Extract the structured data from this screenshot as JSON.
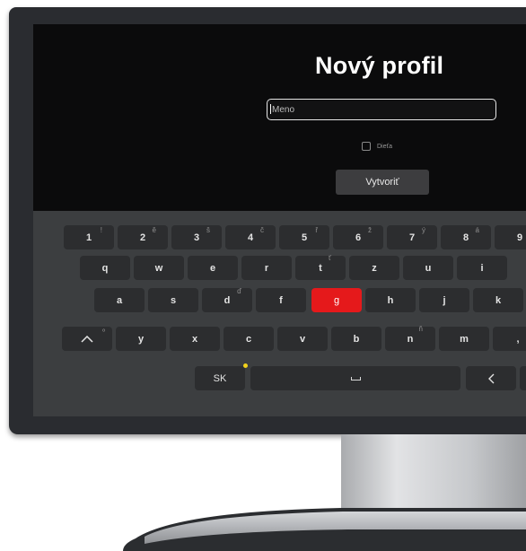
{
  "screen": {
    "title": "Nový profil",
    "name_input": {
      "value": "Meno"
    },
    "child_checkbox": {
      "label": "Dieťa",
      "checked": false
    },
    "create_button": {
      "label": "Vytvoriť"
    }
  },
  "keyboard": {
    "active_key": "g",
    "rows": [
      [
        {
          "label": "1",
          "secondary": "!"
        },
        {
          "label": "2",
          "secondary": "ě"
        },
        {
          "label": "3",
          "secondary": "š"
        },
        {
          "label": "4",
          "secondary": "č"
        },
        {
          "label": "5",
          "secondary": "ř"
        },
        {
          "label": "6",
          "secondary": "ž"
        },
        {
          "label": "7",
          "secondary": "ý"
        },
        {
          "label": "8",
          "secondary": "á"
        },
        {
          "label": "9",
          "secondary": ""
        }
      ],
      [
        {
          "label": "q"
        },
        {
          "label": "w"
        },
        {
          "label": "e"
        },
        {
          "label": "r"
        },
        {
          "label": "t",
          "secondary": "ť"
        },
        {
          "label": "z"
        },
        {
          "label": "u"
        },
        {
          "label": "i"
        }
      ],
      [
        {
          "label": "a"
        },
        {
          "label": "s"
        },
        {
          "label": "d",
          "secondary": "ď"
        },
        {
          "label": "f"
        },
        {
          "label": "g"
        },
        {
          "label": "h"
        },
        {
          "label": "j"
        },
        {
          "label": "k"
        }
      ],
      [
        {
          "label": "",
          "icon": "shift-icon",
          "secondary": "º"
        },
        {
          "label": "y"
        },
        {
          "label": "x"
        },
        {
          "label": "c"
        },
        {
          "label": "v"
        },
        {
          "label": "b"
        },
        {
          "label": "n",
          "secondary": "ň"
        },
        {
          "label": "m"
        },
        {
          "label": ","
        }
      ],
      [
        {
          "label": "SK",
          "icon": "language-indicator-icon"
        },
        {
          "label": "",
          "icon": "space-icon"
        },
        {
          "label": "<",
          "icon": "backspace-icon"
        }
      ]
    ]
  },
  "colors": {
    "accent_active_key": "#e5191b",
    "language_indicator": "#f2d21b",
    "keyboard_panel": "#3c3e40",
    "key": "#2c2d2f"
  }
}
